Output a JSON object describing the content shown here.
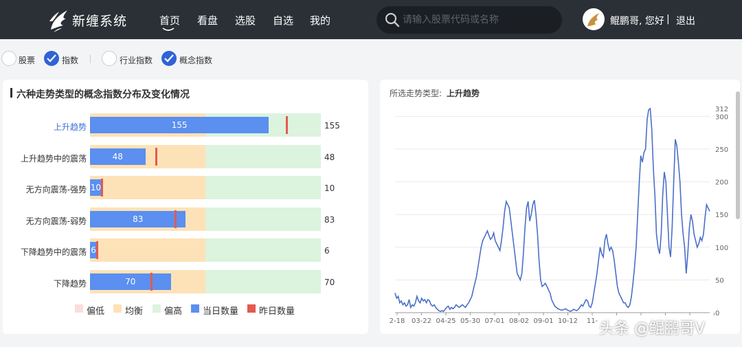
{
  "header": {
    "brand": "新缠系统",
    "nav": [
      {
        "label": "首页",
        "active": true
      },
      {
        "label": "看盘",
        "active": false
      },
      {
        "label": "选股",
        "active": false
      },
      {
        "label": "自选",
        "active": false
      },
      {
        "label": "我的",
        "active": false
      }
    ],
    "search_placeholder": "请输入股票代码或名称",
    "greeting": "鲲鹏哥, 您好",
    "separator": "|",
    "logout": "退出"
  },
  "filters": [
    {
      "label": "股票",
      "checked": false
    },
    {
      "label": "指数",
      "checked": true
    },
    {
      "label": "行业指数",
      "checked": false
    },
    {
      "label": "概念指数",
      "checked": true
    }
  ],
  "left_panel": {
    "title": "六种走势类型的概念指数分布及变化情况",
    "rows": [
      {
        "label": "上升趋势",
        "today": 155,
        "yesterday": 170,
        "value_text": "155",
        "selected": true
      },
      {
        "label": "上升趋势中的震荡",
        "today": 48,
        "yesterday": 57,
        "value_text": "48",
        "selected": false
      },
      {
        "label": "无方向震荡-强势",
        "today": 10,
        "yesterday": 10,
        "value_text": "10",
        "selected": false
      },
      {
        "label": "无方向震荡-弱势",
        "today": 83,
        "yesterday": 74,
        "value_text": "83",
        "selected": false
      },
      {
        "label": "下降趋势中的震荡",
        "today": 6,
        "yesterday": 6,
        "value_text": "6",
        "selected": false
      },
      {
        "label": "下降趋势",
        "today": 70,
        "yesterday": 53,
        "value_text": "70",
        "selected": false
      }
    ],
    "bands": {
      "low_end": 0,
      "mid_end": 100,
      "high_end": 200
    },
    "legend": [
      {
        "label": "偏低",
        "color": "#fddcdc"
      },
      {
        "label": "均衡",
        "color": "#fde2b8"
      },
      {
        "label": "偏高",
        "color": "#dcf3de"
      },
      {
        "label": "当日数量",
        "color": "#5b8ff0"
      },
      {
        "label": "昨日数量",
        "color": "#e35a4f"
      }
    ],
    "colors": {
      "bar": "#5b8ff0",
      "prev": "#e35a4f",
      "mid_band": "#fde2b8",
      "high_band": "#dcf3de"
    }
  },
  "right_panel": {
    "selected_label": "所选走势类型:",
    "selected_value": "上升趋势"
  },
  "chart_data": {
    "type": "line",
    "title": "",
    "xlabel": "",
    "ylabel": "",
    "x_ticks": [
      "2-18",
      "03-22",
      "04-25",
      "05-30",
      "07-01",
      "08-02",
      "09-01",
      "10-12",
      "11-",
      "",
      "",
      "",
      "",
      ""
    ],
    "y_ticks": [
      0,
      50,
      100,
      150,
      200,
      250,
      300,
      312
    ],
    "ylim": [
      0,
      312
    ],
    "grid": true,
    "series": [
      {
        "color": "#4a6fc9",
        "values": [
          30,
          22,
          25,
          15,
          18,
          12,
          15,
          10,
          12,
          20,
          8,
          12,
          10,
          15,
          25,
          18,
          15,
          22,
          18,
          20,
          15,
          20,
          18,
          12,
          10,
          12,
          8,
          5,
          3,
          2,
          3,
          2,
          5,
          8,
          10,
          5,
          8,
          6,
          8,
          12,
          10,
          8,
          10,
          12,
          10,
          8,
          12,
          15,
          20,
          25,
          35,
          45,
          55,
          70,
          85,
          100,
          110,
          115,
          120,
          125,
          118,
          112,
          115,
          122,
          110,
          105,
          100,
          95,
          110,
          130,
          155,
          170,
          165,
          160,
          140,
          120,
          100,
          80,
          60,
          55,
          50,
          60,
          90,
          130,
          160,
          170,
          140,
          150,
          165,
          172,
          150,
          120,
          80,
          50,
          40,
          42,
          45,
          40,
          35,
          30,
          20,
          15,
          10,
          8,
          6,
          5,
          4,
          4,
          5,
          6,
          4,
          3,
          2,
          3,
          5,
          4,
          3,
          5,
          8,
          12,
          10,
          15,
          20,
          18,
          10,
          8,
          15,
          30,
          45,
          60,
          80,
          100,
          90,
          85,
          110,
          120,
          105,
          95,
          100,
          95,
          80,
          60,
          40,
          30,
          25,
          20,
          15,
          15,
          10,
          8,
          12,
          25,
          45,
          70,
          100,
          150,
          200,
          240,
          230,
          245,
          250,
          295,
          310,
          312,
          280,
          220,
          180,
          120,
          100,
          90,
          120,
          180,
          215,
          200,
          150,
          100,
          85,
          130,
          200,
          265,
          255,
          230,
          200,
          150,
          120,
          100,
          60,
          90,
          130,
          150,
          140,
          120,
          110,
          100,
          105,
          115,
          110,
          120,
          145,
          165,
          160,
          155
        ]
      }
    ]
  }
}
